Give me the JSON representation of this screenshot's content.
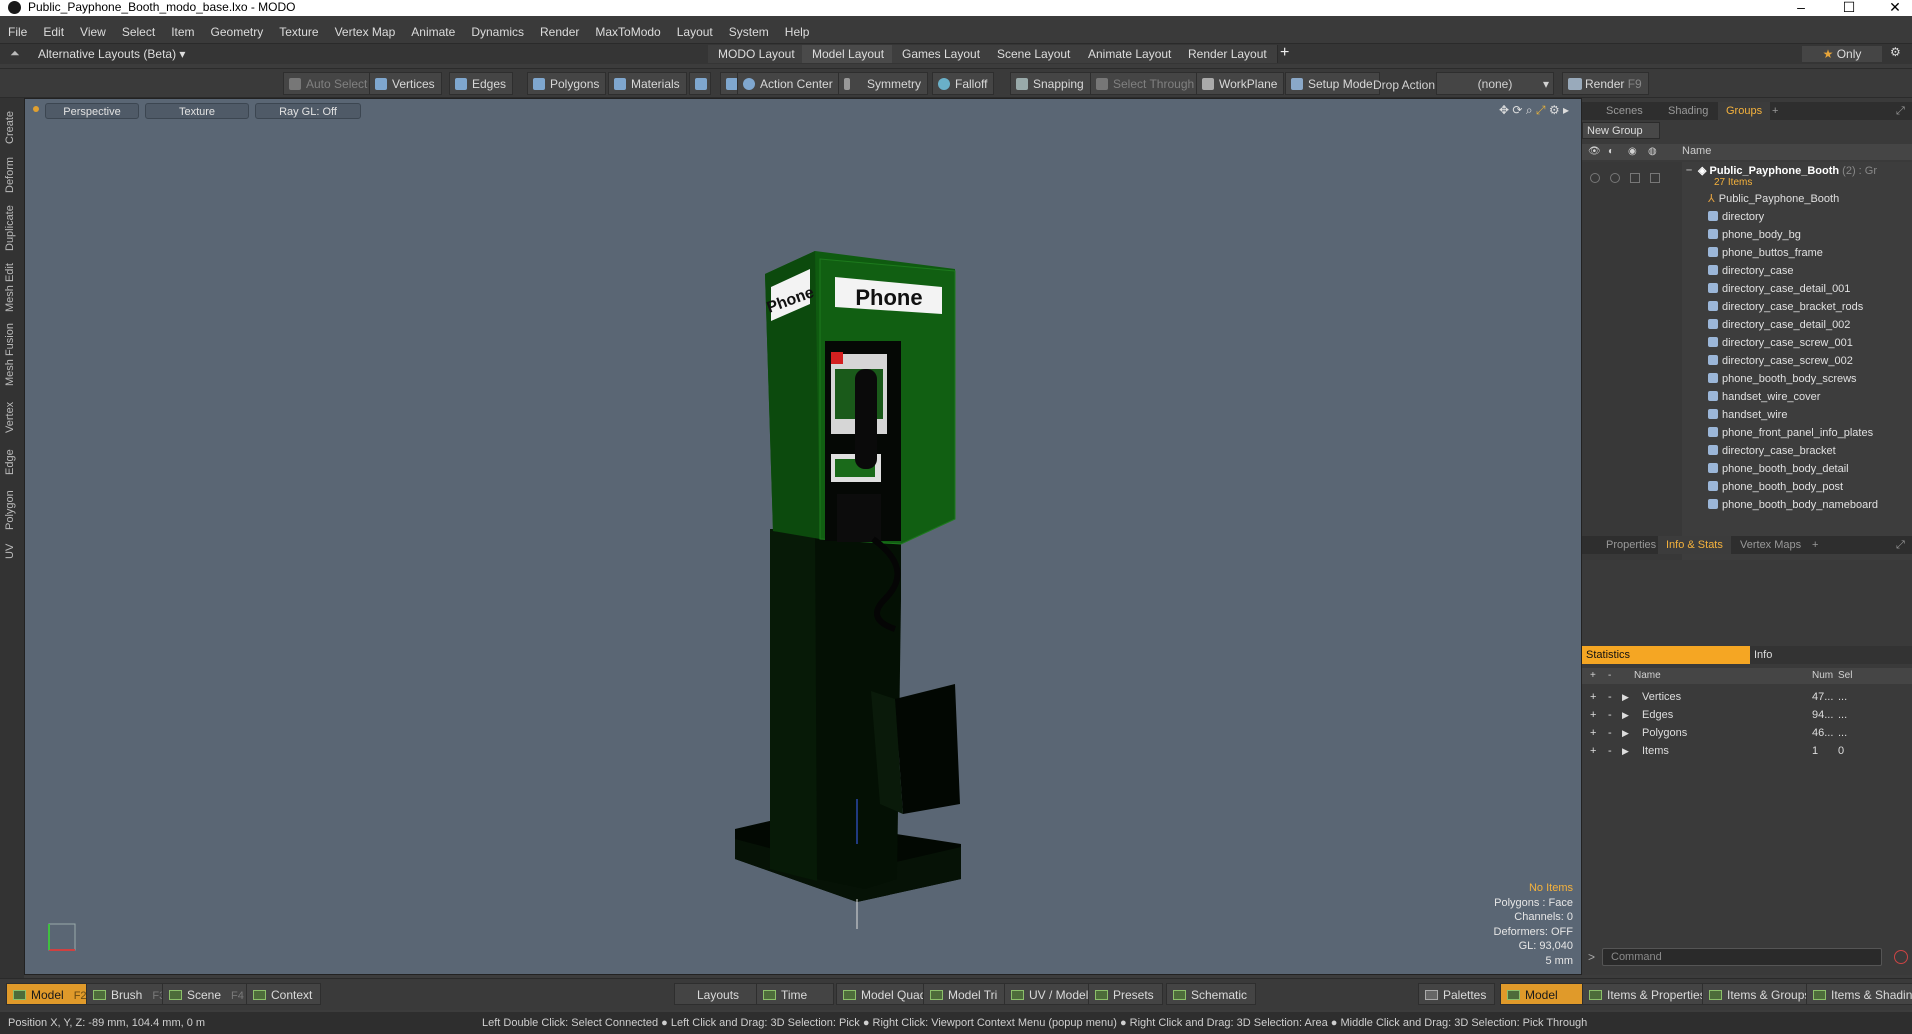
{
  "window": {
    "title": "Public_Payphone_Booth_modo_base.lxo - MODO"
  },
  "menu": [
    "File",
    "Edit",
    "View",
    "Select",
    "Item",
    "Geometry",
    "Texture",
    "Vertex Map",
    "Animate",
    "Dynamics",
    "Render",
    "MaxToModo",
    "Layout",
    "System",
    "Help"
  ],
  "layouts": {
    "alt": "Alternative Layouts (Beta)",
    "tabs": [
      "MODO Layout",
      "Model Layout",
      "Games Layout",
      "Scene Layout",
      "Animate Layout",
      "Render Layout"
    ],
    "only": "Only"
  },
  "toolbar": {
    "auto_select": "Auto Select",
    "vertices": "Vertices",
    "edges": "Edges",
    "polygons": "Polygons",
    "materials": "Materials",
    "action_center": "Action Center",
    "symmetry": "Symmetry",
    "falloff": "Falloff",
    "snapping": "Snapping",
    "select_through": "Select Through",
    "workplane": "WorkPlane",
    "setup_mode": "Setup Mode",
    "drop_action": "Drop Action",
    "drop_value": "(none)",
    "render": "Render",
    "render_key": "F9"
  },
  "lefttabs": [
    "Create",
    "Deform",
    "Duplicate",
    "Mesh Edit",
    "Mesh Fusion",
    "Vertex",
    "Edge",
    "Polygon",
    "UV"
  ],
  "viewport": {
    "perspective": "Perspective",
    "texture": "Texture",
    "raygl": "Ray GL: Off",
    "sign": "Phone",
    "side_sign": "Phone"
  },
  "stats": {
    "items": "No Items",
    "polygons": "Polygons : Face",
    "channels": "Channels: 0",
    "deformers": "Deformers: OFF",
    "gl": "GL: 93,040",
    "scale": "5 mm"
  },
  "panel": {
    "tabs": [
      "Scenes",
      "Shading",
      "Groups"
    ],
    "new_group": "New Group",
    "name_col": "Name",
    "group_name": "Public_Payphone_Booth",
    "group_suffix": "(2) : Gr",
    "group_count": "27 Items",
    "items": [
      "Public_Payphone_Booth",
      "directory",
      "phone_body_bg",
      "phone_buttos_frame",
      "directory_case",
      "directory_case_detail_001",
      "directory_case_bracket_rods",
      "directory_case_detail_002",
      "directory_case_screw_001",
      "directory_case_screw_002",
      "phone_booth_body_screws",
      "handset_wire_cover",
      "handset_wire",
      "phone_front_panel_info_plates",
      "directory_case_bracket",
      "phone_booth_body_detail",
      "phone_booth_body_post",
      "phone_booth_body_nameboard"
    ],
    "tabs2": [
      "Properties",
      "Info & Stats",
      "Vertex Maps"
    ],
    "stat_tab": "Statistics",
    "info_tab": "Info",
    "stat_cols": {
      "name": "Name",
      "num": "Num",
      "sel": "Sel"
    },
    "stat_rows": [
      {
        "name": "Vertices",
        "num": "47...",
        "sel": "..."
      },
      {
        "name": "Edges",
        "num": "94...",
        "sel": "..."
      },
      {
        "name": "Polygons",
        "num": "46...",
        "sel": "..."
      },
      {
        "name": "Items",
        "num": "1",
        "sel": "0"
      }
    ],
    "command": "Command"
  },
  "bottom": {
    "model": "Model",
    "model_key": "F2",
    "brush": "Brush",
    "brush_key": "F3",
    "scene": "Scene",
    "scene_key": "F4",
    "context": "Context",
    "layouts": "Layouts",
    "time": "Time",
    "model_quad": "Model Quad",
    "model_tri": "Model Tri",
    "uv_model": "UV / Model",
    "presets": "Presets",
    "schematic": "Schematic",
    "palettes": "Palettes",
    "model2": "Model",
    "items_props": "Items & Properties",
    "items_groups": "Items & Groups",
    "items_shading": "Items & Shading"
  },
  "status": {
    "position": "Position X, Y, Z:  -89 mm, 104.4 mm, 0 m",
    "hints": "Left Double Click: Select Connected ● Left Click and Drag: 3D Selection: Pick ● Right Click: Viewport Context Menu (popup menu) ● Right Click and Drag: 3D Selection: Area ● Middle Click and Drag: 3D Selection: Pick Through"
  }
}
